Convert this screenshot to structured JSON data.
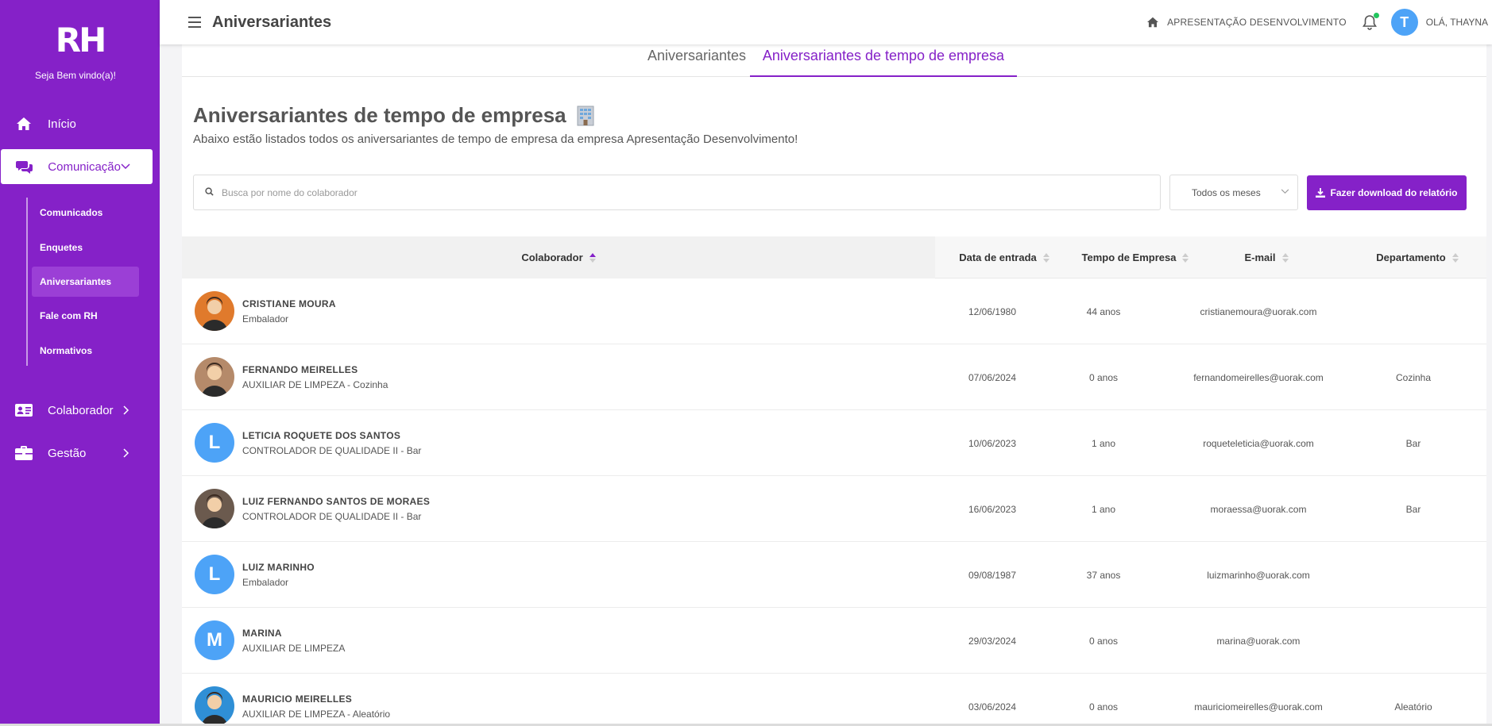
{
  "sidebar": {
    "logo": "RH",
    "welcome": "Seja Bem vindo(a)!",
    "nav": [
      {
        "label": "Início",
        "icon": "home-icon"
      },
      {
        "label": "Comunicação",
        "icon": "chat-icon"
      },
      {
        "label": "Colaborador",
        "icon": "id-card-icon"
      },
      {
        "label": "Gestão",
        "icon": "briefcase-icon"
      }
    ],
    "sub_items": [
      "Comunicados",
      "Enquetes",
      "Aniversariantes",
      "Fale com RH",
      "Normativos"
    ],
    "active_sub": "Aniversariantes"
  },
  "header": {
    "title": "Aniversariantes",
    "company": "APRESENTAÇÃO DESENVOLVIMENTO",
    "avatar_letter": "T",
    "greeting": "OLÁ, THAYNA"
  },
  "tabs": [
    "Aniversariantes",
    "Aniversariantes de tempo de empresa"
  ],
  "content": {
    "title": "Aniversariantes de tempo de empresa",
    "subtitle": "Abaixo estão listados todos os aniversariantes de tempo de empresa da empresa Apresentação Desenvolvimento!",
    "search_placeholder": "Busca por nome do colaborador",
    "month_filter": "Todos os meses",
    "download_label": "Fazer download do relatório"
  },
  "table": {
    "columns": [
      "Colaborador",
      "Data de entrada",
      "Tempo de Empresa",
      "E-mail",
      "Departamento"
    ],
    "rows": [
      {
        "name": "CRISTIANE MOURA",
        "role": "Embalador",
        "date": "12/06/1980",
        "years": "44 anos",
        "email": "cristianemoura@uorak.com",
        "dept": "",
        "avatar": "photo",
        "avatar_color": "#e07a2c"
      },
      {
        "name": "FERNANDO MEIRELLES",
        "role": "AUXILIAR DE LIMPEZA - Cozinha",
        "date": "07/06/2024",
        "years": "0 anos",
        "email": "fernandomeirelles@uorak.com",
        "dept": "Cozinha",
        "avatar": "photo",
        "avatar_color": "#b58a6a"
      },
      {
        "name": "LETICIA ROQUETE DOS SANTOS",
        "role": "CONTROLADOR DE QUALIDADE II - Bar",
        "date": "10/06/2023",
        "years": "1 ano",
        "email": "roqueteleticia@uorak.com",
        "dept": "Bar",
        "avatar": "L",
        "avatar_color": "#4da3f7"
      },
      {
        "name": "LUIZ FERNANDO SANTOS DE MORAES",
        "role": "CONTROLADOR DE QUALIDADE II - Bar",
        "date": "16/06/2023",
        "years": "1 ano",
        "email": "moraessa@uorak.com",
        "dept": "Bar",
        "avatar": "photo",
        "avatar_color": "#6b5a4e"
      },
      {
        "name": "LUIZ MARINHO",
        "role": "Embalador",
        "date": "09/08/1987",
        "years": "37 anos",
        "email": "luizmarinho@uorak.com",
        "dept": "",
        "avatar": "L",
        "avatar_color": "#4da3f7"
      },
      {
        "name": "MARINA",
        "role": "AUXILIAR DE LIMPEZA",
        "date": "29/03/2024",
        "years": "0 anos",
        "email": "marina@uorak.com",
        "dept": "",
        "avatar": "M",
        "avatar_color": "#4da3f7"
      },
      {
        "name": "MAURICIO MEIRELLES",
        "role": "AUXILIAR DE LIMPEZA - Aleatório",
        "date": "03/06/2024",
        "years": "0 anos",
        "email": "mauriciomeirelles@uorak.com",
        "dept": "Aleatório",
        "avatar": "photo",
        "avatar_color": "#2f8fd6"
      }
    ]
  },
  "colors": {
    "brand": "#8521c8",
    "avatar_blue": "#4da3f7",
    "notification": "#22c55e"
  }
}
